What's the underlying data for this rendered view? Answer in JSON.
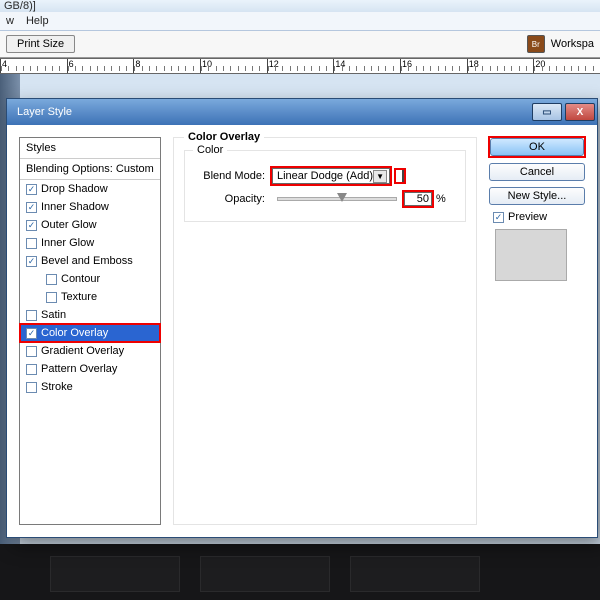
{
  "title_fragment": "GB/8)]",
  "menu": {
    "view": "w",
    "help": "Help"
  },
  "toolbar": {
    "print_size": "Print Size",
    "workspace": "Workspa",
    "ws_icon": "Br"
  },
  "ruler_ticks": [
    "4",
    "6",
    "8",
    "10",
    "12",
    "14",
    "16",
    "18",
    "20"
  ],
  "dialog": {
    "title": "Layer Style",
    "styles_header": "Styles",
    "blending_label": "Blending Options: Custom",
    "effects": [
      {
        "label": "Drop Shadow",
        "checked": true,
        "indent": false
      },
      {
        "label": "Inner Shadow",
        "checked": true,
        "indent": false
      },
      {
        "label": "Outer Glow",
        "checked": true,
        "indent": false
      },
      {
        "label": "Inner Glow",
        "checked": false,
        "indent": false
      },
      {
        "label": "Bevel and Emboss",
        "checked": true,
        "indent": false
      },
      {
        "label": "Contour",
        "checked": false,
        "indent": true
      },
      {
        "label": "Texture",
        "checked": false,
        "indent": true
      },
      {
        "label": "Satin",
        "checked": false,
        "indent": false
      },
      {
        "label": "Color Overlay",
        "checked": true,
        "indent": false,
        "selected": true,
        "highlight": true
      },
      {
        "label": "Gradient Overlay",
        "checked": false,
        "indent": false
      },
      {
        "label": "Pattern Overlay",
        "checked": false,
        "indent": false
      },
      {
        "label": "Stroke",
        "checked": false,
        "indent": false
      }
    ],
    "panel": {
      "title": "Color Overlay",
      "group": "Color",
      "blend_mode_label": "Blend Mode:",
      "blend_mode_value": "Linear Dodge (Add)",
      "opacity_label": "Opacity:",
      "opacity_value": "50",
      "opacity_unit": "%"
    },
    "buttons": {
      "ok": "OK",
      "cancel": "Cancel",
      "new_style": "New Style..."
    },
    "preview_label": "Preview"
  }
}
